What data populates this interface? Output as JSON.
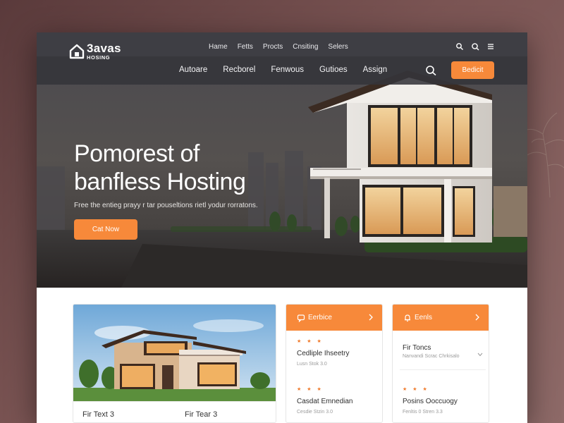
{
  "brand": {
    "name": "3avas",
    "sub": "HOSING"
  },
  "top_nav": [
    "Hame",
    "Fetts",
    "Procts",
    "Cnsiting",
    "Selers"
  ],
  "main_nav": [
    "Autoare",
    "Recborel",
    "Fenwous",
    "Gutioes",
    "Assign"
  ],
  "top_icons": [
    "search-icon",
    "search-icon",
    "menu-icon"
  ],
  "header_cta": "Bedicit",
  "hero": {
    "title_line1": "Pomorest of",
    "title_line2": "banfless Hosting",
    "subtitle": "Free the entieg prayy r tar pouseltions rietl yodur rorratons.",
    "cta": "Cat Now"
  },
  "image_card": {
    "labels": [
      "Fir Text 3",
      "Fir Tear 3"
    ]
  },
  "cards": [
    {
      "header": "Eerbice",
      "header_icon": "chat-icon",
      "items": [
        {
          "rating": "★ ★ ★",
          "title": "Cedliple Ihseetry",
          "meta": "Lusn Stok 3.0"
        },
        {
          "rating": "★ ★ ★",
          "title": "Casdat Emnedian",
          "meta": "Cesdie Stzin 3.0"
        }
      ]
    },
    {
      "header": "Eenls",
      "header_icon": "bell-icon",
      "items": [
        {
          "rating": "",
          "title": "Fir Toncs",
          "meta": "Nanvandi Scrac Chrkisalo"
        },
        {
          "rating": "★ ★ ★",
          "title": "Posins Ooccuogy",
          "meta": "Fenltis 0 Stren 3.3"
        }
      ]
    }
  ],
  "colors": {
    "accent": "#f7893a",
    "backdrop": "#6e4a4a",
    "hero_dark": "#3d3d42"
  }
}
